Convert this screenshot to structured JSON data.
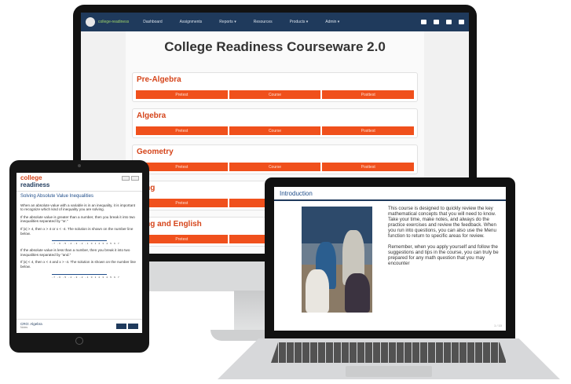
{
  "desktop": {
    "brand": "college-readiness",
    "nav": [
      "Dashboard",
      "Assignments",
      "Reports ▾",
      "Resources",
      "Products ▾",
      "Admin ▾"
    ],
    "page_title": "College Readiness Courseware 2.0",
    "courses": [
      {
        "name": "Pre-Algebra",
        "buttons": [
          "Pretest",
          "Course",
          "Posttest"
        ]
      },
      {
        "name": "Algebra",
        "buttons": [
          "Pretest",
          "Course",
          "Posttest"
        ]
      },
      {
        "name": "Geometry",
        "buttons": [
          "Pretest",
          "Course",
          "Posttest"
        ]
      },
      {
        "name": "...ing",
        "buttons": [
          "Pretest",
          "C..."
        ]
      },
      {
        "name": "...ing and English",
        "buttons": [
          "Pretest",
          "C..."
        ]
      }
    ]
  },
  "tablet": {
    "logo_line1": "college",
    "logo_line2": "readiness",
    "lesson_title": "Solving Absolute Value Inequalities",
    "p1": "When an absolute value with a variable is in an inequality, it is important to recognize which kind of inequality you are solving.",
    "p2": "If the absolute value is greater than a number, then you break it into two inequalities separated by \"or.\"",
    "p3": "If |x| > 4, then x > 4 or x < -4. The solution is shown on the number line below.",
    "p4": "If the absolute value is less than a number, then you break it into two inequalities separated by \"and.\"",
    "p5": "If |x| < 4, then x < 4 and x > -4. The solution is shown on the number line below.",
    "numbers": "-7 -6 -5 -4 -3 -2 -1 0 1 2 3 4 5 6 7",
    "footer_course": "CRO: Algebra",
    "footer_sub": "Notes"
  },
  "laptop": {
    "section_title": "Introduction",
    "p1": "This course is designed to quickly review the key mathematical concepts that you will need to know. Take your time, make notes, and always do the practice exercises and review the feedback. When you run into questions, you can also use the Menu function to return to specific areas for review.",
    "p2": "Remember, when you apply yourself and follow the suggestions and tips in the course, you can truly be prepared for any math question that you may encounter",
    "page_indicator": "1 / 10"
  },
  "colors": {
    "accent": "#f0501c",
    "navy": "#1f3a5c"
  }
}
